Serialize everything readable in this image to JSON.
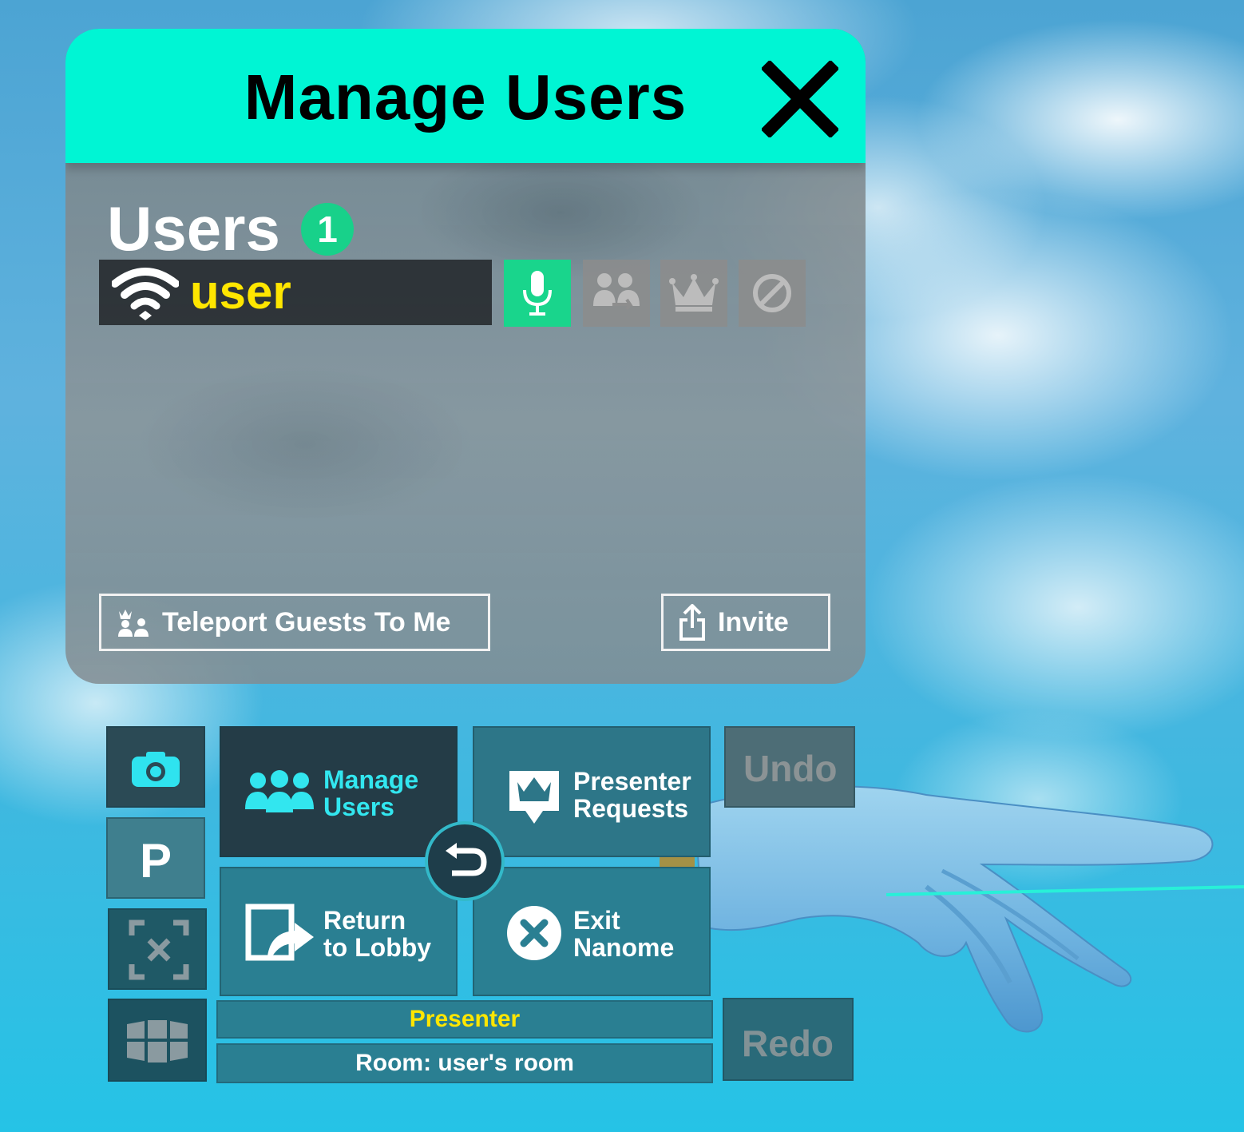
{
  "panel": {
    "title": "Manage Users",
    "close_icon": "close-icon",
    "users_heading": "Users",
    "users_count": "1",
    "users": [
      {
        "name": "user",
        "connection_icon": "wifi-icon",
        "name_color": "#ffe600"
      }
    ],
    "row_actions": [
      {
        "icon": "microphone-icon",
        "state": "active"
      },
      {
        "icon": "teleport-to-user-icon",
        "state": "disabled"
      },
      {
        "icon": "crown-icon",
        "state": "disabled"
      },
      {
        "icon": "ban-icon",
        "state": "disabled"
      }
    ],
    "teleport_button": "Teleport Guests To Me",
    "invite_button": "Invite"
  },
  "wrist_menu": {
    "side_buttons": [
      {
        "icon": "camera-icon"
      },
      {
        "label": "P"
      },
      {
        "icon": "recenter-icon"
      },
      {
        "icon": "windows-icon"
      }
    ],
    "tiles": {
      "manage_users": {
        "line1": "Manage",
        "line2": "Users",
        "icon": "users-icon"
      },
      "presenter_requests": {
        "line1": "Presenter",
        "line2": "Requests",
        "icon": "presenter-requests-icon"
      },
      "return_to_lobby": {
        "line1": "Return",
        "line2": "to Lobby",
        "icon": "return-lobby-icon"
      },
      "exit_nanome": {
        "line1": "Exit",
        "line2": "Nanome",
        "icon": "exit-icon"
      }
    },
    "undo": "Undo",
    "redo": "Redo",
    "back_icon": "back-arrow-icon",
    "role": "Presenter",
    "room": "Room: user's room"
  },
  "colors": {
    "header": "#00f5d4",
    "accent_green": "#19d58c",
    "role_text": "#ffe600",
    "tile_accent": "#32e6ef"
  }
}
